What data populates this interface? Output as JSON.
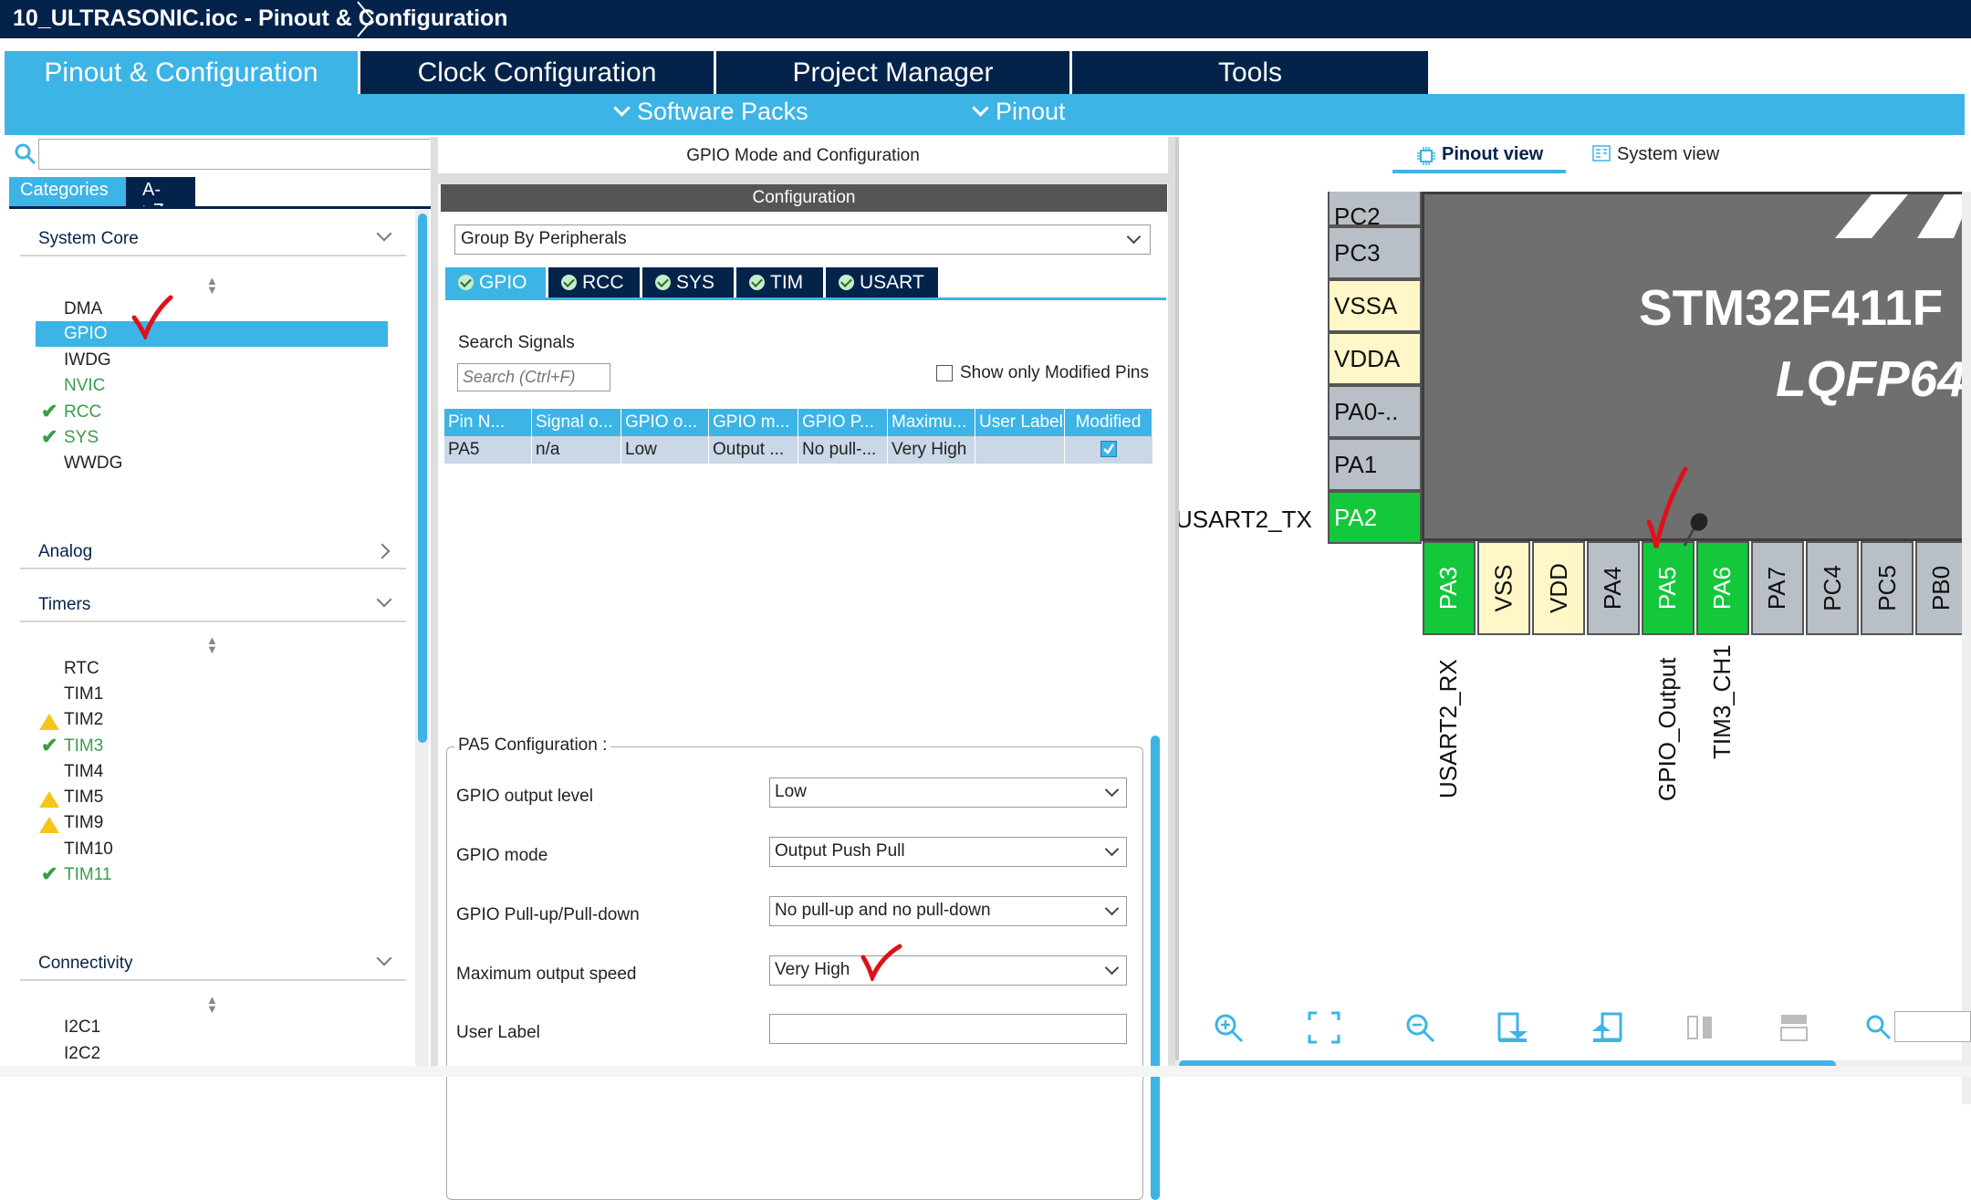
{
  "window": {
    "title": "10_ULTRASONIC.ioc - Pinout & Configuration"
  },
  "tabs": [
    {
      "label": "Pinout & Configuration"
    },
    {
      "label": "Clock Configuration"
    },
    {
      "label": "Project Manager"
    },
    {
      "label": "Tools"
    }
  ],
  "subtabs": [
    {
      "label": "Software Packs"
    },
    {
      "label": "Pinout"
    }
  ],
  "left": {
    "search_placeholder": "",
    "view_tabs": [
      "Categories",
      "A->Z"
    ],
    "categories": [
      {
        "name": "System Core",
        "expanded": true,
        "items": [
          {
            "label": "DMA",
            "state": "normal"
          },
          {
            "label": "GPIO",
            "state": "selected"
          },
          {
            "label": "IWDG",
            "state": "normal"
          },
          {
            "label": "NVIC",
            "state": "green"
          },
          {
            "label": "RCC",
            "state": "ok"
          },
          {
            "label": "SYS",
            "state": "ok"
          },
          {
            "label": "WWDG",
            "state": "normal"
          }
        ]
      },
      {
        "name": "Analog",
        "expanded": false,
        "items": []
      },
      {
        "name": "Timers",
        "expanded": true,
        "items": [
          {
            "label": "RTC",
            "state": "normal"
          },
          {
            "label": "TIM1",
            "state": "normal"
          },
          {
            "label": "TIM2",
            "state": "warning"
          },
          {
            "label": "TIM3",
            "state": "ok"
          },
          {
            "label": "TIM4",
            "state": "normal"
          },
          {
            "label": "TIM5",
            "state": "warning"
          },
          {
            "label": "TIM9",
            "state": "warning"
          },
          {
            "label": "TIM10",
            "state": "normal"
          },
          {
            "label": "TIM11",
            "state": "ok"
          }
        ]
      },
      {
        "name": "Connectivity",
        "expanded": true,
        "items": [
          {
            "label": "I2C1",
            "state": "normal"
          },
          {
            "label": "I2C2",
            "state": "normal"
          }
        ]
      }
    ]
  },
  "mid": {
    "title": "GPIO Mode and Configuration",
    "config_header": "Configuration",
    "group_by": "Group By Peripherals",
    "peripheral_tabs": [
      "GPIO",
      "RCC",
      "SYS",
      "TIM",
      "USART"
    ],
    "search_label": "Search Signals",
    "search_placeholder": "Search (Ctrl+F)",
    "show_modified_label": "Show only Modified Pins",
    "table": {
      "columns": [
        "Pin N...",
        "Signal o...",
        "GPIO o...",
        "GPIO m...",
        "GPIO P...",
        "Maximu...",
        "User Label",
        "Modified"
      ],
      "rows": [
        [
          "PA5",
          "n/a",
          "Low",
          "Output ...",
          "No pull-...",
          "Very High",
          "",
          ""
        ]
      ],
      "modified_checked": true
    },
    "pin_config": {
      "legend": "PA5 Configuration :",
      "fields": [
        {
          "label": "GPIO output level",
          "value": "Low"
        },
        {
          "label": "GPIO mode",
          "value": "Output Push Pull"
        },
        {
          "label": "GPIO Pull-up/Pull-down",
          "value": "No pull-up and no pull-down"
        },
        {
          "label": "Maximum output speed",
          "value": "Very High"
        },
        {
          "label": "User Label",
          "value": ""
        }
      ]
    }
  },
  "right": {
    "view_tabs": [
      "Pinout view",
      "System view"
    ],
    "chip_name": "STM32F411F",
    "chip_package": "LQFP64",
    "left_pins": [
      {
        "label": "PC2",
        "color": "grey"
      },
      {
        "label": "PC3",
        "color": "grey"
      },
      {
        "label": "VSSA",
        "color": "yellow"
      },
      {
        "label": "VDDA",
        "color": "yellow"
      },
      {
        "label": "PA0-..",
        "color": "grey"
      },
      {
        "label": "PA1",
        "color": "grey"
      },
      {
        "label": "PA2",
        "color": "green"
      }
    ],
    "bottom_pins": [
      {
        "label": "PA3",
        "color": "green"
      },
      {
        "label": "VSS",
        "color": "yellow"
      },
      {
        "label": "VDD",
        "color": "yellow"
      },
      {
        "label": "PA4",
        "color": "grey"
      },
      {
        "label": "PA5",
        "color": "green"
      },
      {
        "label": "PA6",
        "color": "green"
      },
      {
        "label": "PA7",
        "color": "grey"
      },
      {
        "label": "PC4",
        "color": "grey"
      },
      {
        "label": "PC5",
        "color": "grey"
      },
      {
        "label": "PB0",
        "color": "grey"
      }
    ],
    "signal_labels": {
      "pa2": "USART2_TX",
      "pa3": "USART2_RX",
      "pa5": "GPIO_Output",
      "pa6": "TIM3_CH1"
    },
    "toolbar_icons": [
      "zoom-in-icon",
      "fit-icon",
      "zoom-out-icon",
      "export-icon",
      "import-icon",
      "split-icon",
      "layout-icon",
      "search-icon"
    ]
  },
  "colors": {
    "navy": "#03234b",
    "accent": "#3cb4e6",
    "pin_green": "#14c83c",
    "pin_yellow": "#fff7c8",
    "pin_grey": "#b9bfc6",
    "annotation": "#e0101a"
  }
}
